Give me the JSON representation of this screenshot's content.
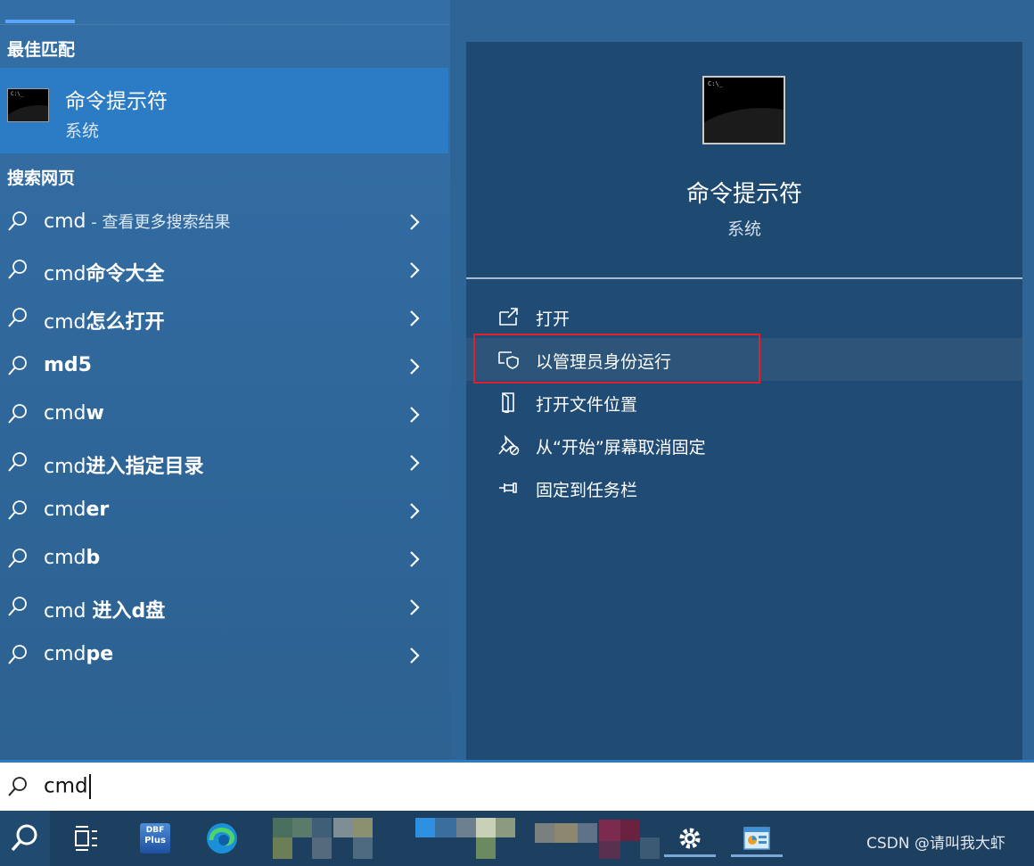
{
  "left": {
    "best_match_title": "最佳匹配",
    "best_match": {
      "name": "命令提示符",
      "subtitle": "系统",
      "icon": "cmd-app-icon"
    },
    "web_title": "搜索网页",
    "suggestions": [
      {
        "prefix": "cmd",
        "bold": "",
        "desc": " - 查看更多搜索结果"
      },
      {
        "prefix": "cmd",
        "bold": "命令大全",
        "desc": ""
      },
      {
        "prefix": "cmd",
        "bold": "怎么打开",
        "desc": ""
      },
      {
        "prefix": "",
        "bold": "md5",
        "desc": ""
      },
      {
        "prefix": "cmd",
        "bold": "w",
        "desc": ""
      },
      {
        "prefix": "cmd",
        "bold": "进入指定目录",
        "desc": ""
      },
      {
        "prefix": "cmd",
        "bold": "er",
        "desc": ""
      },
      {
        "prefix": "cmd",
        "bold": "b",
        "desc": ""
      },
      {
        "prefix": "cmd ",
        "bold": "进入d盘",
        "desc": ""
      },
      {
        "prefix": "cmd",
        "bold": "pe",
        "desc": ""
      }
    ]
  },
  "right": {
    "app_name": "命令提示符",
    "app_subtitle": "系统",
    "actions": [
      {
        "label": "打开",
        "icon": "open-icon"
      },
      {
        "label": "以管理员身份运行",
        "icon": "shield-icon",
        "highlighted": true
      },
      {
        "label": "打开文件位置",
        "icon": "folder-location-icon"
      },
      {
        "label": "从“开始”屏幕取消固定",
        "icon": "unpin-icon"
      },
      {
        "label": "固定到任务栏",
        "icon": "pin-icon"
      }
    ]
  },
  "search": {
    "query": "cmd"
  },
  "taskbar": {
    "dbf_label_1": "DBF",
    "dbf_label_2": "Plus",
    "watermark": "CSDN @请叫我大虾"
  },
  "colors": {
    "accent": "#2b7cc4",
    "highlight_box": "#e0202a"
  }
}
